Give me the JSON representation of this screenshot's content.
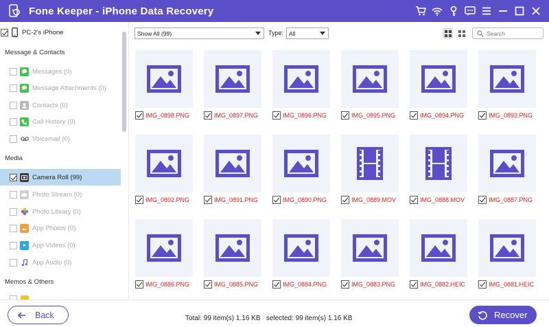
{
  "window": {
    "title": "Fone Keeper - iPhone Data Recovery",
    "accent_color": "#5b4fc9",
    "title_icons": [
      "cart-icon",
      "wifi-icon",
      "key-icon",
      "chat-icon",
      "menu-icon",
      "minimize-icon",
      "maximize-icon",
      "close-icon"
    ]
  },
  "sidebar": {
    "device": {
      "label": "PC-2's iPhone",
      "checked": true
    },
    "sections": [
      {
        "title": "Message & Contacts",
        "items": [
          {
            "label": "Messages (0)",
            "icon": "messages-icon",
            "checked": false
          },
          {
            "label": "Message Attachments (0)",
            "icon": "message-attachments-icon",
            "checked": false
          },
          {
            "label": "Contacts (0)",
            "icon": "contacts-icon",
            "checked": false
          },
          {
            "label": "Call History (0)",
            "icon": "phone-icon",
            "checked": false
          },
          {
            "label": "Voicemail (0)",
            "icon": "voicemail-icon",
            "checked": false
          }
        ]
      },
      {
        "title": "Media",
        "items": [
          {
            "label": "Camera Roll (99)",
            "icon": "camera-icon",
            "checked": true,
            "active": true
          },
          {
            "label": "Photo Stream (0)",
            "icon": "photo-stream-icon",
            "checked": false
          },
          {
            "label": "Photo Library (0)",
            "icon": "photo-library-icon",
            "checked": false
          },
          {
            "label": "App Photos (0)",
            "icon": "app-photos-icon",
            "checked": false
          },
          {
            "label": "App Videos (0)",
            "icon": "app-videos-icon",
            "checked": false
          },
          {
            "label": "App Audio (0)",
            "icon": "music-icon",
            "checked": false
          }
        ]
      },
      {
        "title": "Memos & Others",
        "items": []
      }
    ]
  },
  "toolbar": {
    "filter_selected": "Show All (99)",
    "type_label": "Type:",
    "type_selected": "All",
    "search_placeholder": "Search"
  },
  "files": [
    {
      "name": "IMG_0898.PNG",
      "kind": "image",
      "checked": true
    },
    {
      "name": "IMG_0897.PNG",
      "kind": "image",
      "checked": true
    },
    {
      "name": "IMG_0896.PNG",
      "kind": "image",
      "checked": true
    },
    {
      "name": "IMG_0895.PNG",
      "kind": "image",
      "checked": true
    },
    {
      "name": "IMG_0894.PNG",
      "kind": "image",
      "checked": true
    },
    {
      "name": "IMG_0893.PNG",
      "kind": "image",
      "checked": true
    },
    {
      "name": "IMG_0892.PNG",
      "kind": "image",
      "checked": true
    },
    {
      "name": "IMG_0891.PNG",
      "kind": "image",
      "checked": true
    },
    {
      "name": "IMG_0890.PNG",
      "kind": "image",
      "checked": true
    },
    {
      "name": "IMG_0889.MOV",
      "kind": "video",
      "checked": true
    },
    {
      "name": "IMG_0888.MOV",
      "kind": "video",
      "checked": true
    },
    {
      "name": "IMG_0887.PNG",
      "kind": "image",
      "checked": true
    },
    {
      "name": "IMG_0886.PNG",
      "kind": "image",
      "checked": true
    },
    {
      "name": "IMG_0885.PNG",
      "kind": "image",
      "checked": true
    },
    {
      "name": "IMG_0884.PNG",
      "kind": "image",
      "checked": true
    },
    {
      "name": "IMG_0883.PNG",
      "kind": "image",
      "checked": true
    },
    {
      "name": "IMG_0882.HEIC",
      "kind": "image",
      "checked": true
    },
    {
      "name": "IMG_0881.HEIC",
      "kind": "image",
      "checked": true
    }
  ],
  "footer": {
    "back_label": "Back",
    "total_text": "Total: 99 item(s) 1.16 KB   selected: 99 item(s) 1.16 KB",
    "recover_label": "Recover"
  }
}
